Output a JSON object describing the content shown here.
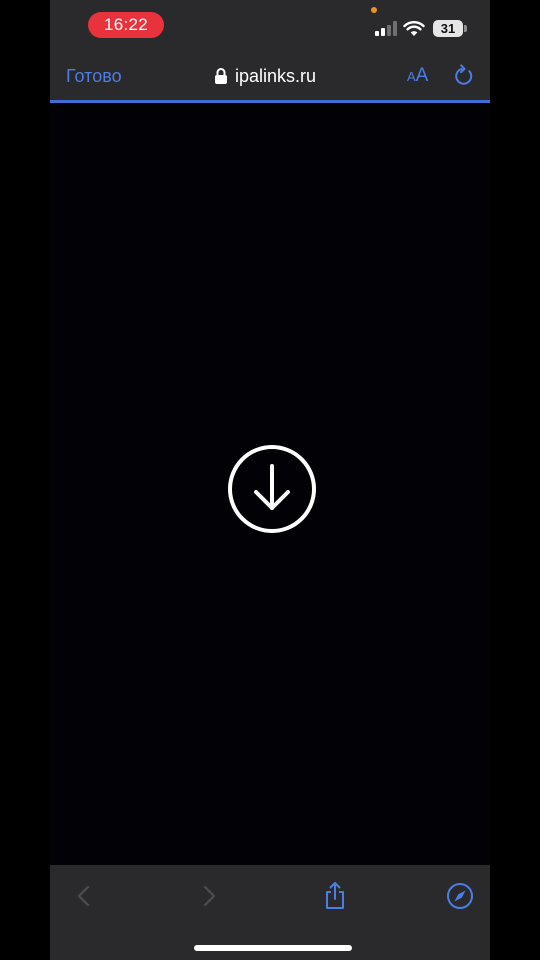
{
  "status_bar": {
    "time": "16:22",
    "battery": "31"
  },
  "nav_bar": {
    "done_label": "Готово",
    "url": "ipalinks.ru",
    "text_size_small": "A",
    "text_size_large": "A"
  },
  "content": {
    "center_icon": "download-circle-icon"
  },
  "toolbar": {
    "icons": [
      "back-icon",
      "forward-icon",
      "share-icon",
      "compass-icon"
    ]
  },
  "colors": {
    "accent": "#4c7de4",
    "time_pill": "#e8323c",
    "chrome_bg": "#2a2a2d",
    "page_bg": "#020206"
  }
}
